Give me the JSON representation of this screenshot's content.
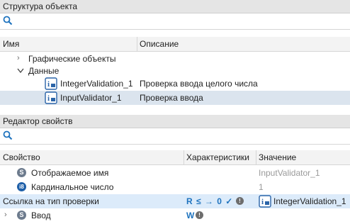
{
  "structure_panel": {
    "title": "Структура объекта",
    "search": {
      "placeholder": "",
      "icon": "search-icon"
    },
    "columns": {
      "name": "Имя",
      "description": "Описание"
    },
    "tree": [
      {
        "label": "Графические объекты",
        "expanded": false
      },
      {
        "label": "Данные",
        "expanded": true
      },
      {
        "label": "IntegerValidation_1",
        "description": "Проверка ввода целого числа",
        "icon": "validation-icon"
      },
      {
        "label": "InputValidator_1",
        "description": "Проверка ввода",
        "icon": "validation-icon",
        "selected": true
      }
    ]
  },
  "properties_panel": {
    "title": "Редактор свойств",
    "search": {
      "placeholder": "",
      "icon": "search-icon"
    },
    "columns": {
      "property": "Свойство",
      "characteristics": "Характеристики",
      "value": "Значение"
    },
    "rows": [
      {
        "badge": "S",
        "label": "Отображаемое имя",
        "characteristics": "",
        "value": "InputValidator_1",
        "value_muted": true
      },
      {
        "badge": "i8",
        "label": "Кардинальное число",
        "characteristics": "",
        "value": "1",
        "value_muted": true
      },
      {
        "badge": "",
        "label": "Ссылка на тип проверки",
        "characteristics": "R ≤ → 0 ✓",
        "value": "IntegerValidation_1",
        "selected": true
      },
      {
        "badge": "S",
        "label": "Ввод",
        "characteristics": "W",
        "value": "",
        "expandable": true
      }
    ]
  },
  "colors": {
    "header_bg": "#e5e5e5",
    "selected_row": "#dbe4ee",
    "selected_row_blue": "#dcebfa",
    "accent": "#1e73be"
  }
}
